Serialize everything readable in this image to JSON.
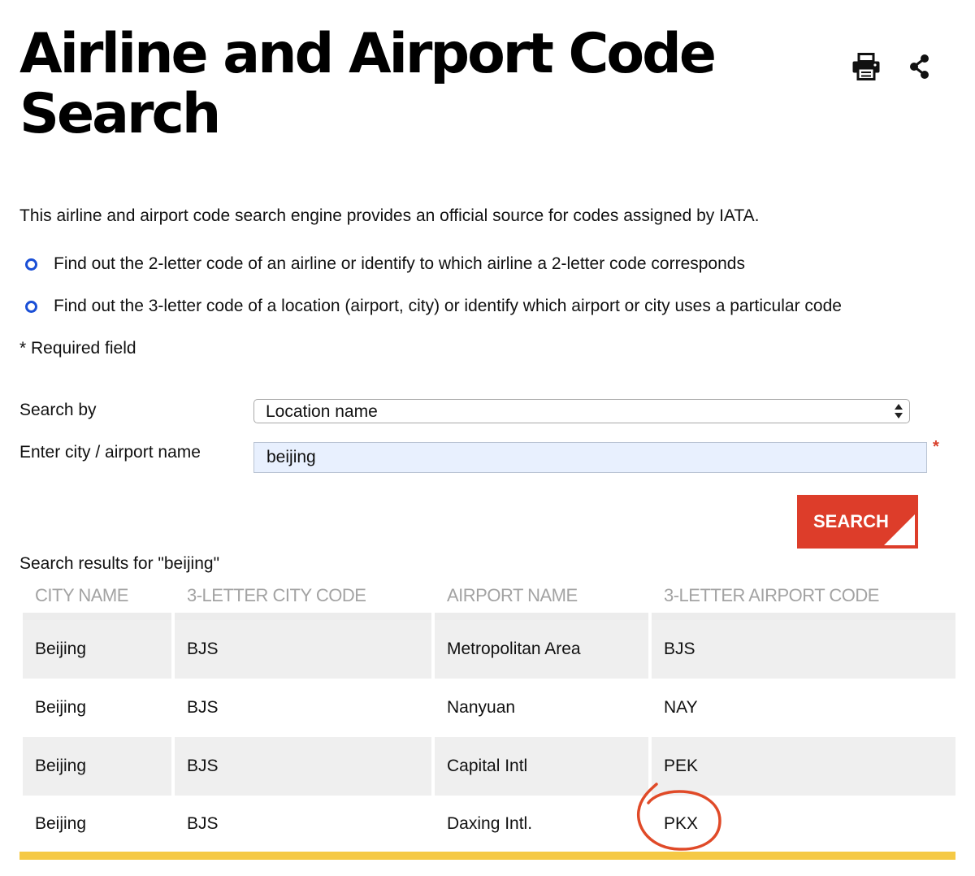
{
  "page": {
    "title": "Airline and Airport Code Search",
    "intro": "This airline and airport code search engine provides an official source for codes assigned by IATA.",
    "bullets": [
      "Find out the 2-letter code of an airline or identify to which airline a 2-letter code corresponds",
      "Find out the 3-letter code of a location (airport, city) or identify which airport or city uses a particular code"
    ],
    "required_note": "* Required field",
    "accent_color": "#dd3d2a",
    "bullet_color": "#1a4fd6",
    "rule_color": "#f5c945"
  },
  "actions": {
    "print_icon": "printer-icon",
    "share_icon": "share-icon"
  },
  "form": {
    "search_by_label": "Search by",
    "search_by_value": "Location name",
    "city_label": "Enter city / airport name",
    "city_value": "beijing",
    "required_marker": "*",
    "search_button": "SEARCH"
  },
  "results": {
    "caption": "Search results for \"beijing\"",
    "columns": [
      "CITY NAME",
      "3-LETTER CITY CODE",
      "AIRPORT NAME",
      "3-LETTER AIRPORT CODE"
    ],
    "rows": [
      [
        "Beijing",
        "BJS",
        "Metropolitan Area",
        "BJS"
      ],
      [
        "Beijing",
        "BJS",
        "Nanyuan",
        "NAY"
      ],
      [
        "Beijing",
        "BJS",
        "Capital Intl",
        "PEK"
      ],
      [
        "Beijing",
        "BJS",
        "Daxing Intl.",
        "PKX"
      ]
    ],
    "highlighted_code": "PKX"
  }
}
